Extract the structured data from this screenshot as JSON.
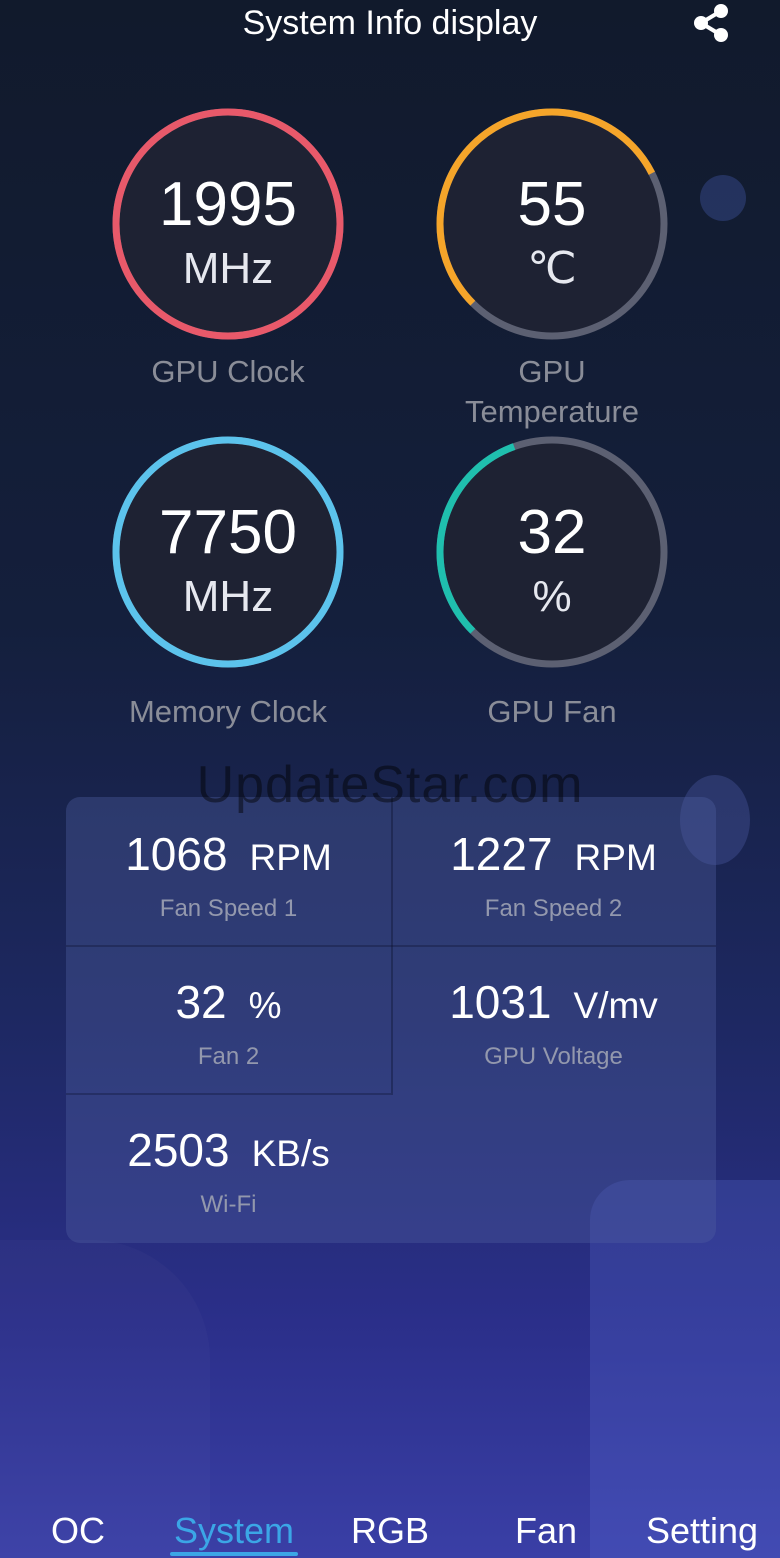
{
  "header": {
    "title": "System Info display",
    "share_icon": "share-icon"
  },
  "colors": {
    "gpu_clock": "#e8596a",
    "gpu_temperature": "#f5a52a",
    "memory_clock": "#5cc3ec",
    "gpu_fan": "#1fbfae",
    "track": "#5c6072",
    "accent": "#3ba6e6"
  },
  "gauges": {
    "gpu_clock": {
      "value": "1995",
      "unit": "MHz",
      "label": "GPU Clock",
      "level_percent": 100
    },
    "gpu_temperature": {
      "value": "55",
      "unit": "℃",
      "label1": "GPU",
      "label2": "Temperature",
      "level_percent": 55
    },
    "memory_clock": {
      "value": "7750",
      "unit": "MHz",
      "label": "Memory Clock",
      "level_percent": 100
    },
    "gpu_fan": {
      "value": "32",
      "unit": "%",
      "label": "GPU Fan",
      "level_percent": 32
    }
  },
  "stats": {
    "fan_speed_1": {
      "value": "1068",
      "unit": "RPM",
      "label": "Fan Speed 1"
    },
    "fan_speed_2": {
      "value": "1227",
      "unit": "RPM",
      "label": "Fan Speed 2"
    },
    "fan_2": {
      "value": "32",
      "unit": "%",
      "label": "Fan 2"
    },
    "gpu_voltage": {
      "value": "1031",
      "unit": "V/mv",
      "label": "GPU Voltage"
    },
    "wifi": {
      "value": "2503",
      "unit": "KB/s",
      "label": "Wi-Fi"
    }
  },
  "watermark": "UpdateStar.com",
  "tabs": {
    "oc": "OC",
    "system": "System",
    "rgb": "RGB",
    "fan": "Fan",
    "setting": "Setting",
    "active": "System"
  }
}
